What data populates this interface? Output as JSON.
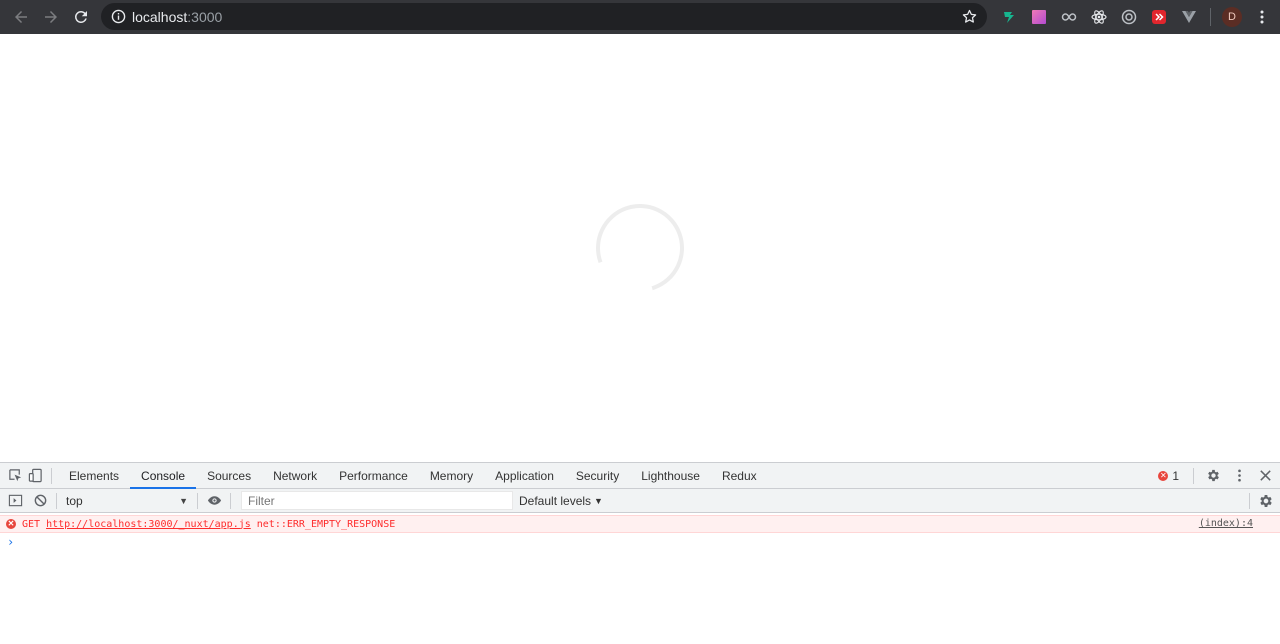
{
  "browser": {
    "url_host": "localhost",
    "url_port": ":3000",
    "avatar_letter": "D",
    "extensions": [
      "ext-green-icon",
      "ext-gradient-icon",
      "ext-infinity-icon",
      "ext-react-icon",
      "ext-target-icon",
      "ext-red-icon",
      "ext-vue-icon"
    ]
  },
  "devtools": {
    "tabs": [
      "Elements",
      "Console",
      "Sources",
      "Network",
      "Performance",
      "Memory",
      "Application",
      "Security",
      "Lighthouse",
      "Redux"
    ],
    "active_tab": "Console",
    "error_count": "1",
    "context": "top",
    "filter_placeholder": "Filter",
    "levels": "Default levels",
    "messages": [
      {
        "method": "GET",
        "url": "http://localhost:3000/_nuxt/app.js",
        "error": "net::ERR_EMPTY_RESPONSE",
        "source": "(index):4"
      }
    ],
    "prompt": "›"
  },
  "colors": {
    "chrome_bg": "#35363a",
    "omnibox_bg": "#202124",
    "accent": "#1a73e8",
    "error": "#e8453c"
  }
}
